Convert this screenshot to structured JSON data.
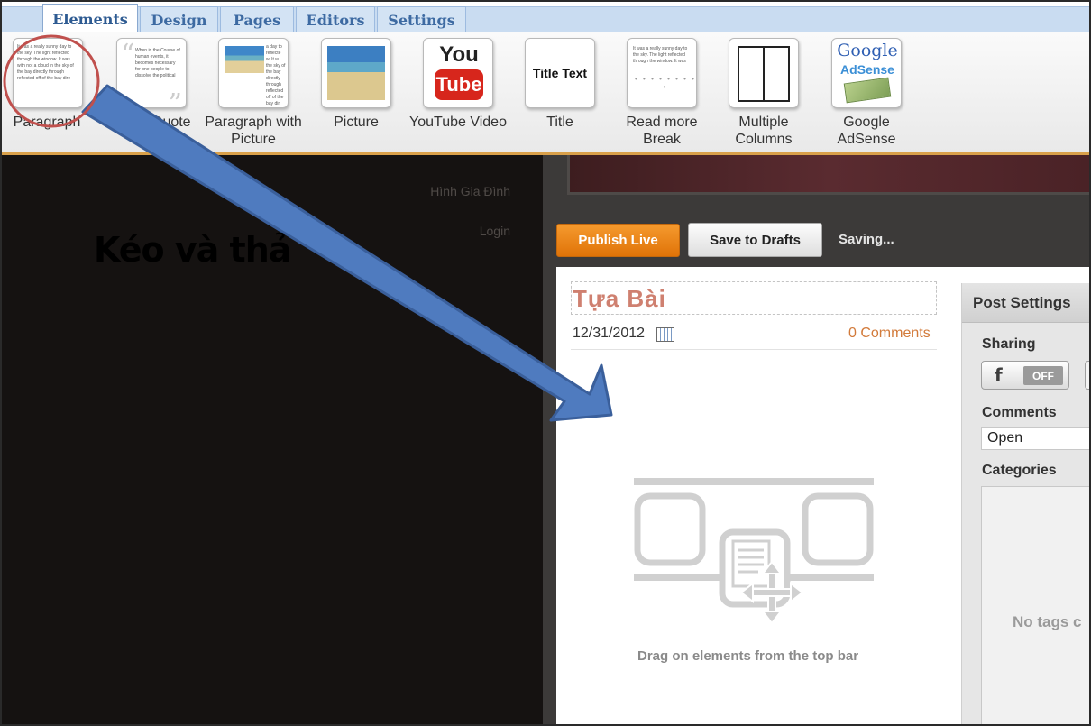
{
  "tabs": [
    {
      "label": "Elements",
      "active": true
    },
    {
      "label": "Design",
      "active": false
    },
    {
      "label": "Pages",
      "active": false
    },
    {
      "label": "Editors",
      "active": false
    },
    {
      "label": "Settings",
      "active": false
    }
  ],
  "elements": [
    {
      "label": "Paragraph",
      "icon": "paragraph-icon",
      "preview": "It was a really sunny day to the sky. The light reflected through the window. It was with not a cloud in the sky of the bay directly through reflected off of the bay dire"
    },
    {
      "label": "Block Quote",
      "icon": "block-quote-icon",
      "preview": "When in the Course of human events, it becomes necessary for one people to dissolve the political"
    },
    {
      "label": "Paragraph with Picture",
      "icon": "paragraph-picture-icon",
      "preview": "a day to reflecte w. It w the sky of the bay directly through reflected off of the bay dir"
    },
    {
      "label": "Picture",
      "icon": "picture-icon"
    },
    {
      "label": "YouTube Video",
      "icon": "youtube-icon",
      "you": "You",
      "tube": "Tube"
    },
    {
      "label": "Title",
      "icon": "title-text-icon",
      "preview": "Title Text"
    },
    {
      "label": "Read more Break",
      "icon": "read-more-icon",
      "preview": "It was a really sunny day to the sky. The light reflected through the window. It was"
    },
    {
      "label": "Multiple Columns",
      "icon": "columns-icon"
    },
    {
      "label": "Google AdSense",
      "icon": "adsense-icon",
      "google": "Google",
      "adsense": "AdSense"
    }
  ],
  "site_nav": [
    "Hình Gia Đình",
    "Login"
  ],
  "annotation": {
    "text": "Kéo và thả"
  },
  "actions": {
    "publish": "Publish Live",
    "save_drafts": "Save to Drafts",
    "status": "Saving..."
  },
  "post": {
    "title": "Tựa Bài",
    "date": "12/31/2012",
    "comments": "0 Comments",
    "drop_hint": "Drag on elements from the top bar"
  },
  "post_settings": {
    "heading": "Post Settings",
    "sharing_label": "Sharing",
    "facebook_state": "OFF",
    "comments_label": "Comments",
    "comments_value": "Open",
    "categories_label": "Categories",
    "no_tags": "No tags c"
  },
  "colors": {
    "accent_orange": "#e07308",
    "tab_blue": "#3d6aa2",
    "arrow_blue": "#4f7bbf",
    "circle_red": "#c0504d"
  }
}
